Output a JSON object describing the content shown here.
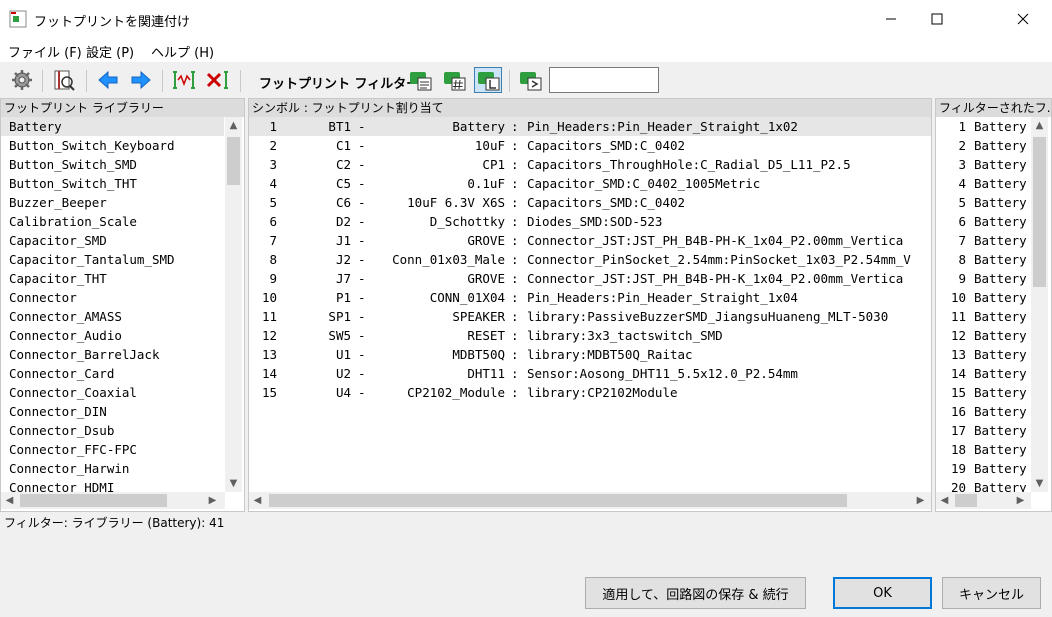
{
  "window": {
    "title": "フットプリントを関連付け"
  },
  "menu": [
    {
      "label": "ファイル (F)"
    },
    {
      "label": "設定 (P)"
    },
    {
      "label": "ヘルプ (H)"
    }
  ],
  "toolbar": {
    "filter_label": "フットプリント フィルター:",
    "filter_value": ""
  },
  "libraries": {
    "header": "フットプリント ライブラリー",
    "items": [
      "Battery",
      "Button_Switch_Keyboard",
      "Button_Switch_SMD",
      "Button_Switch_THT",
      "Buzzer_Beeper",
      "Calibration_Scale",
      "Capacitor_SMD",
      "Capacitor_Tantalum_SMD",
      "Capacitor_THT",
      "Connector",
      "Connector_AMASS",
      "Connector_Audio",
      "Connector_BarrelJack",
      "Connector_Card",
      "Connector_Coaxial",
      "Connector_DIN",
      "Connector_Dsub",
      "Connector_FFC-FPC",
      "Connector_Harwin",
      "Connector_HDMI"
    ]
  },
  "symbols": {
    "header": "シンボル : フットプリント割り当て",
    "rows": [
      {
        "num": "1",
        "ref": "BT1",
        "dash": "-",
        "value": "Battery",
        "sep": ":",
        "fp": "Pin_Headers:Pin_Header_Straight_1x02"
      },
      {
        "num": "2",
        "ref": "C1",
        "dash": "-",
        "value": "10uF",
        "sep": ":",
        "fp": "Capacitors_SMD:C_0402"
      },
      {
        "num": "3",
        "ref": "C2",
        "dash": "-",
        "value": "CP1",
        "sep": ":",
        "fp": "Capacitors_ThroughHole:C_Radial_D5_L11_P2.5"
      },
      {
        "num": "4",
        "ref": "C5",
        "dash": "-",
        "value": "0.1uF",
        "sep": ":",
        "fp": "Capacitor_SMD:C_0402_1005Metric"
      },
      {
        "num": "5",
        "ref": "C6",
        "dash": "-",
        "value": "10uF 6.3V X6S",
        "sep": ":",
        "fp": "Capacitors_SMD:C_0402"
      },
      {
        "num": "6",
        "ref": "D2",
        "dash": "-",
        "value": "D_Schottky",
        "sep": ":",
        "fp": "Diodes_SMD:SOD-523"
      },
      {
        "num": "7",
        "ref": "J1",
        "dash": "-",
        "value": "GROVE",
        "sep": ":",
        "fp": "Connector_JST:JST_PH_B4B-PH-K_1x04_P2.00mm_Vertica"
      },
      {
        "num": "8",
        "ref": "J2",
        "dash": "-",
        "value": "Conn_01x03_Male",
        "sep": ":",
        "fp": "Connector_PinSocket_2.54mm:PinSocket_1x03_P2.54mm_V"
      },
      {
        "num": "9",
        "ref": "J7",
        "dash": "-",
        "value": "GROVE",
        "sep": ":",
        "fp": "Connector_JST:JST_PH_B4B-PH-K_1x04_P2.00mm_Vertica"
      },
      {
        "num": "10",
        "ref": "P1",
        "dash": "-",
        "value": "CONN_01X04",
        "sep": ":",
        "fp": "Pin_Headers:Pin_Header_Straight_1x04"
      },
      {
        "num": "11",
        "ref": "SP1",
        "dash": "-",
        "value": "SPEAKER",
        "sep": ":",
        "fp": "library:PassiveBuzzerSMD_JiangsuHuaneng_MLT-5030"
      },
      {
        "num": "12",
        "ref": "SW5",
        "dash": "-",
        "value": "RESET",
        "sep": ":",
        "fp": "library:3x3_tactswitch_SMD"
      },
      {
        "num": "13",
        "ref": "U1",
        "dash": "-",
        "value": "MDBT50Q",
        "sep": ":",
        "fp": "library:MDBT50Q_Raitac"
      },
      {
        "num": "14",
        "ref": "U2",
        "dash": "-",
        "value": "DHT11",
        "sep": ":",
        "fp": "Sensor:Aosong_DHT11_5.5x12.0_P2.54mm"
      },
      {
        "num": "15",
        "ref": "U4",
        "dash": "-",
        "value": "CP2102_Module",
        "sep": ":",
        "fp": "library:CP2102Module"
      }
    ]
  },
  "filtered": {
    "header": "フィルターされたフ...",
    "rows": [
      {
        "num": "1",
        "name": "Battery"
      },
      {
        "num": "2",
        "name": "Battery"
      },
      {
        "num": "3",
        "name": "Battery"
      },
      {
        "num": "4",
        "name": "Battery"
      },
      {
        "num": "5",
        "name": "Battery"
      },
      {
        "num": "6",
        "name": "Battery"
      },
      {
        "num": "7",
        "name": "Battery"
      },
      {
        "num": "8",
        "name": "Battery"
      },
      {
        "num": "9",
        "name": "Battery"
      },
      {
        "num": "10",
        "name": "Battery"
      },
      {
        "num": "11",
        "name": "Battery"
      },
      {
        "num": "12",
        "name": "Battery"
      },
      {
        "num": "13",
        "name": "Battery"
      },
      {
        "num": "14",
        "name": "Battery"
      },
      {
        "num": "15",
        "name": "Battery"
      },
      {
        "num": "16",
        "name": "Battery"
      },
      {
        "num": "17",
        "name": "Battery"
      },
      {
        "num": "18",
        "name": "Battery"
      },
      {
        "num": "19",
        "name": "Battery"
      },
      {
        "num": "20",
        "name": "Battery"
      }
    ]
  },
  "status": "フィルター: ライブラリー (Battery): 41",
  "buttons": {
    "apply": "適用して、回路図の保存 & 続行",
    "ok": "OK",
    "cancel": "キャンセル"
  },
  "icons": [
    "gear-icon",
    "library-browser-icon",
    "arrow-left-icon",
    "arrow-right-icon",
    "auto-associate-icon",
    "delete-association-icon",
    "filter-keyword-icon",
    "filter-pincount-icon",
    "filter-library-icon",
    "filter-text-icon"
  ],
  "colors": {
    "accent": "#0078d7",
    "arrow_blue": "#1e90ff",
    "chip_green": "#2e9e3e"
  }
}
